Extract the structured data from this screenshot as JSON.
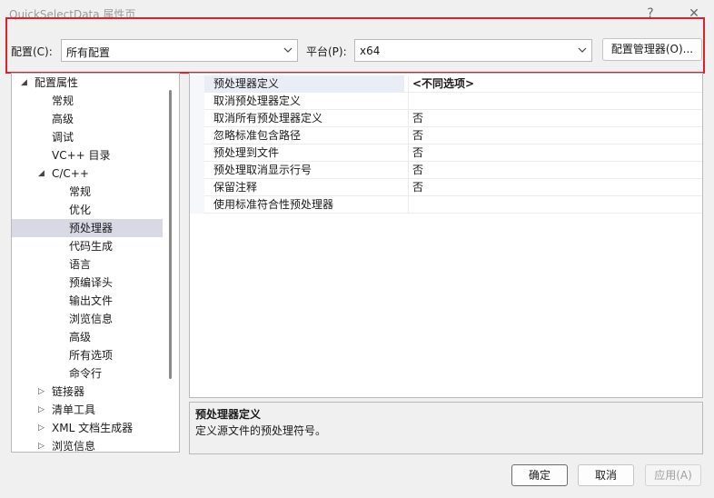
{
  "window": {
    "title": "QuickSelectData 属性页",
    "help_glyph": "?",
    "close_glyph": "✕"
  },
  "config_row": {
    "config_label": "配置(C):",
    "config_value": "所有配置",
    "platform_label": "平台(P):",
    "platform_value": "x64",
    "manager_button": "配置管理器(O)..."
  },
  "tree": {
    "items": [
      {
        "label": "配置属性",
        "expander": "◢"
      },
      {
        "label": "常规"
      },
      {
        "label": "高级"
      },
      {
        "label": "调试"
      },
      {
        "label": "VC++ 目录"
      },
      {
        "label": "C/C++",
        "expander": "◢"
      },
      {
        "label": "常规"
      },
      {
        "label": "优化"
      },
      {
        "label": "预处理器"
      },
      {
        "label": "代码生成"
      },
      {
        "label": "语言"
      },
      {
        "label": "预编译头"
      },
      {
        "label": "输出文件"
      },
      {
        "label": "浏览信息"
      },
      {
        "label": "高级"
      },
      {
        "label": "所有选项"
      },
      {
        "label": "命令行"
      },
      {
        "label": "链接器",
        "expander": "▷"
      },
      {
        "label": "清单工具",
        "expander": "▷"
      },
      {
        "label": "XML 文档生成器",
        "expander": "▷"
      },
      {
        "label": "浏览信息",
        "expander": "▷"
      }
    ]
  },
  "grid": {
    "rows": [
      {
        "name": "预处理器定义",
        "value": "<不同选项>"
      },
      {
        "name": "取消预处理器定义",
        "value": ""
      },
      {
        "name": "取消所有预处理器定义",
        "value": "否"
      },
      {
        "name": "忽略标准包含路径",
        "value": "否"
      },
      {
        "name": "预处理到文件",
        "value": "否"
      },
      {
        "name": "预处理取消显示行号",
        "value": "否"
      },
      {
        "name": "保留注释",
        "value": "否"
      },
      {
        "name": "使用标准符合性预处理器",
        "value": ""
      }
    ]
  },
  "description": {
    "title": "预处理器定义",
    "text": "定义源文件的预处理符号。"
  },
  "buttons": {
    "ok": "确定",
    "cancel": "取消",
    "apply": "应用(A)"
  },
  "colors": {
    "highlight_border": "#e0202a",
    "tree_selection": "#d9d9e6"
  }
}
